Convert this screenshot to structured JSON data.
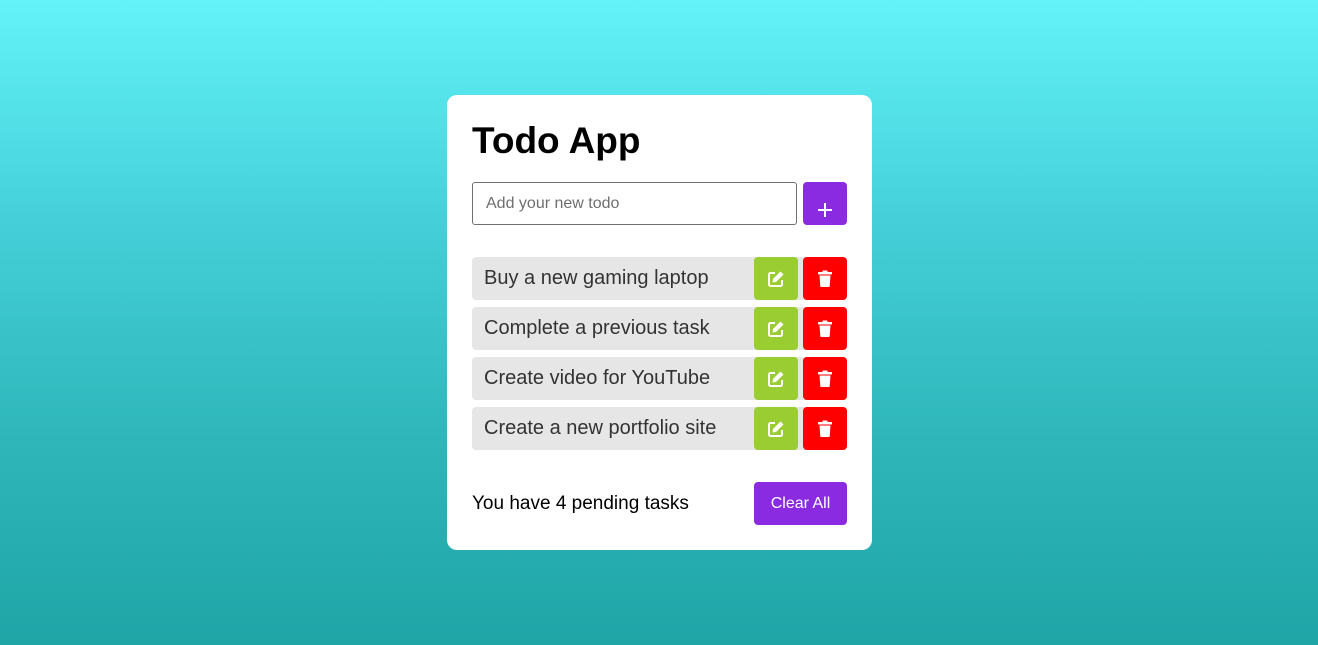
{
  "app": {
    "title": "Todo App"
  },
  "input": {
    "placeholder": "Add your new todo",
    "value": "",
    "add_icon": "plus-icon"
  },
  "todos": [
    {
      "text": "Buy a new gaming laptop",
      "edit_icon": "edit-icon",
      "delete_icon": "trash-icon"
    },
    {
      "text": "Complete a previous task",
      "edit_icon": "edit-icon",
      "delete_icon": "trash-icon"
    },
    {
      "text": "Create video for YouTube",
      "edit_icon": "edit-icon",
      "delete_icon": "trash-icon"
    },
    {
      "text": "Create a new portfolio site",
      "edit_icon": "edit-icon",
      "delete_icon": "trash-icon"
    }
  ],
  "footer": {
    "pending_text": "You have 4 pending tasks",
    "clear_all_label": "Clear All"
  },
  "colors": {
    "accent": "#8a2be2",
    "edit": "#9acd32",
    "delete": "#ff0000",
    "item_bg": "#e6e6e6",
    "background_top": "#63f3f8",
    "background_bottom": "#1fa5a6"
  }
}
